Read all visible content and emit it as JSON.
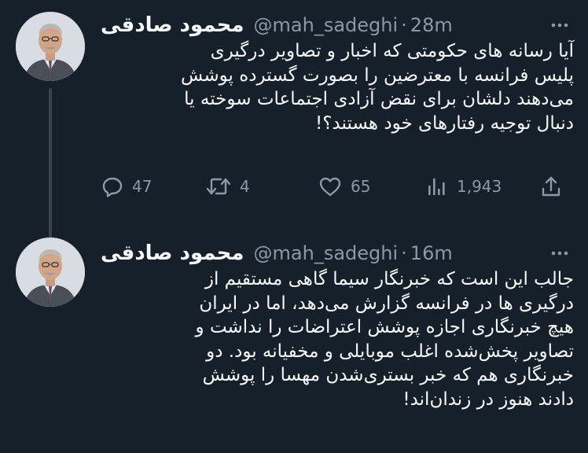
{
  "colors": {
    "background": "#15202b",
    "text_primary": "#f7f9f9",
    "text_secondary": "#8b98a5",
    "thread_line": "#38444d"
  },
  "tweets": [
    {
      "author_name": "محمود صادقی",
      "handle": "@mah_sadeghi",
      "separator": "·",
      "time": "28m",
      "text": "آیا رسانه های حکومتی که اخبار و تصاویر درگیری\nپلیس فرانسه با معترضین را بصورت گسترده پوشش\nمی‌دهند دلشان برای نقض آزادی اجتماعات سوخته یا\nدنبال توجیه رفتارهای خود هستند؟!",
      "stats": {
        "replies": "47",
        "retweets": "4",
        "likes": "65",
        "views": "1,943"
      },
      "icons": {
        "more": "more-horizontal-icon",
        "reply": "reply-bubble-icon",
        "retweet": "retweet-arrows-icon",
        "like": "heart-icon",
        "views": "views-bars-icon",
        "share": "share-upload-icon"
      }
    },
    {
      "author_name": "محمود صادقی",
      "handle": "@mah_sadeghi",
      "separator": "·",
      "time": "16m",
      "text": "جالب این است که خبرنگار سیما گاهی مستقیم از\nدرگیری ها در فرانسه گزارش می‌دهد، اما در ایران\nهیچ خبرنگاری اجازه پوشش اعتراضات را نداشت و\nتصاویر پخش‌شده اغلب موبایلی و مخفیانه بود. دو\nخبرنگاری هم که خبر بستری‌شدن مهسا را پوشش\nدادند هنوز در زندان‌اند!",
      "icons": {
        "more": "more-horizontal-icon"
      }
    }
  ]
}
